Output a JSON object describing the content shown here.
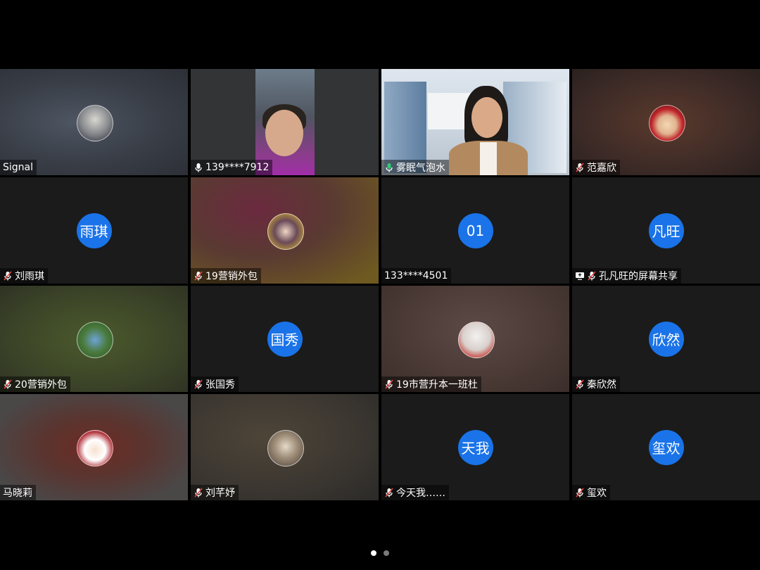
{
  "tiles": [
    {
      "name": "Signal",
      "mic": "none",
      "avatar": {
        "type": "photo",
        "icon": "user-photo-avatar"
      },
      "bg": "radial-gradient(ellipse at 40% 50%, #4e5663 0%, #3a3f48 50%, #2c2f36 100%)"
    },
    {
      "name": "139****7912",
      "mic": "on",
      "avatar": {
        "type": "video-face"
      },
      "bg": "#323436"
    },
    {
      "name": "雾眠气泡水",
      "mic": "speaking",
      "active": true,
      "avatar": {
        "type": "video-room"
      },
      "bg": "#cfd8e1"
    },
    {
      "name": "范嘉欣",
      "mic": "muted",
      "avatar": {
        "type": "photo",
        "icon": "cartoon-avatar"
      },
      "bg": "radial-gradient(ellipse at 50% 50%, #5a3a2c 0%, #3e2b27 60%, #2a211f 100%)"
    },
    {
      "name": "刘雨琪",
      "mic": "muted",
      "avatar": {
        "type": "text",
        "text": "雨琪"
      },
      "bg": "#1b1b1b"
    },
    {
      "name": "19营销外包",
      "mic": "muted",
      "avatar": {
        "type": "photo",
        "icon": "portrait-avatar"
      },
      "bg": "radial-gradient(ellipse at 35% 30%, #6b2a3f 0%, #5a3a32 45%, #6e5a20 90%)"
    },
    {
      "name": "133****4501",
      "mic": "none",
      "avatar": {
        "type": "text",
        "text": "01"
      },
      "bg": "#1b1b1b"
    },
    {
      "name": "孔凡旺的屏幕共享",
      "mic": "muted",
      "screen_share": true,
      "avatar": {
        "type": "text",
        "text": "凡旺"
      },
      "bg": "#1b1b1b"
    },
    {
      "name": "20营销外包",
      "mic": "muted",
      "avatar": {
        "type": "photo",
        "icon": "flowers-avatar"
      },
      "bg": "radial-gradient(ellipse at 50% 50%, #4b5a2c 0%, #3d4628 55%, #2f3324 100%)"
    },
    {
      "name": "张国秀",
      "mic": "muted",
      "avatar": {
        "type": "text",
        "text": "国秀"
      },
      "bg": "#1b1b1b"
    },
    {
      "name": "19市营升本一班杜",
      "mic": "muted",
      "avatar": {
        "type": "photo",
        "icon": "doll-avatar"
      },
      "bg": "radial-gradient(ellipse at 50% 40%, #5b4a46 0%, #4b3a35 55%, #3a2e2a 100%)"
    },
    {
      "name": "秦欣然",
      "mic": "muted",
      "avatar": {
        "type": "text",
        "text": "欣然"
      },
      "bg": "#1b1b1b"
    },
    {
      "name": "马晓莉",
      "mic": "none",
      "avatar": {
        "type": "photo",
        "icon": "cartoon-girl-avatar"
      },
      "bg": "radial-gradient(ellipse at 50% 50%, #6e2a22 0%, #5a3530 40%, #4a4747 80%)"
    },
    {
      "name": "刘芊妤",
      "mic": "muted",
      "avatar": {
        "type": "photo",
        "icon": "cat-photo-avatar"
      },
      "bg": "radial-gradient(ellipse at 40% 40%, #4e4538 0%, #3c3731 55%, #2b2a28 100%)"
    },
    {
      "name": "今天我……",
      "mic": "muted",
      "avatar": {
        "type": "text",
        "text": "天我"
      },
      "bg": "#1b1b1b"
    },
    {
      "name": "玺欢",
      "mic": "muted",
      "avatar": {
        "type": "text",
        "text": "玺欢"
      },
      "bg": "#1b1b1b"
    }
  ],
  "colors": {
    "avatar_blue": "#1a73e8",
    "speaking_green": "#2ecc71",
    "muted_red": "#e84545",
    "dot_active": "#ffffff",
    "dot_inactive": "#7a7a7a"
  },
  "pager": {
    "pages": 2,
    "current": 0
  }
}
